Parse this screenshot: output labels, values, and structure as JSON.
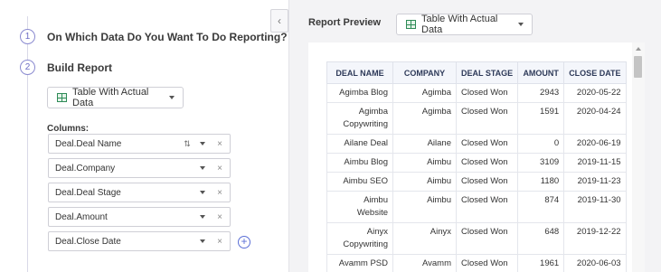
{
  "steps": [
    {
      "number": "1",
      "title": "On Which Data Do You Want To Do Reporting?"
    },
    {
      "number": "2",
      "title": "Build Report"
    }
  ],
  "report_type": {
    "label": "Table With Actual Data"
  },
  "columns_label": "Columns:",
  "columns": [
    {
      "value": "Deal.Deal Name",
      "sort_icon": "sort-icon"
    },
    {
      "value": "Deal.Company"
    },
    {
      "value": "Deal.Deal Stage"
    },
    {
      "value": "Deal.Amount"
    },
    {
      "value": "Deal.Close Date"
    }
  ],
  "icons": {
    "remove": "×",
    "add": "+",
    "collapse": "‹",
    "sort": "⇅"
  },
  "preview": {
    "title": "Report Preview",
    "view_select": "Table With Actual Data"
  },
  "table": {
    "headers": [
      "DEAL NAME",
      "COMPANY",
      "DEAL STAGE",
      "AMOUNT",
      "CLOSE DATE"
    ],
    "rows": [
      [
        "Agimba Blog",
        "Agimba",
        "Closed Won",
        "2943",
        "2020-05-22"
      ],
      [
        "Agimba Copywriting",
        "Agimba",
        "Closed Won",
        "1591",
        "2020-04-24"
      ],
      [
        "Ailane Deal",
        "Ailane",
        "Closed Won",
        "0",
        "2020-06-19"
      ],
      [
        "Aimbu Blog",
        "Aimbu",
        "Closed Won",
        "3109",
        "2019-11-15"
      ],
      [
        "Aimbu SEO",
        "Aimbu",
        "Closed Won",
        "1180",
        "2019-11-23"
      ],
      [
        "Aimbu Website",
        "Aimbu",
        "Closed Won",
        "874",
        "2019-11-30"
      ],
      [
        "Ainyx Copywriting",
        "Ainyx",
        "Closed Won",
        "648",
        "2019-12-22"
      ],
      [
        "Avamm PSD",
        "Avamm",
        "Closed Won",
        "1961",
        "2020-06-03"
      ]
    ]
  },
  "colors": {
    "accent": "#5b6fd6",
    "sheet_green": "#2e8b57"
  }
}
